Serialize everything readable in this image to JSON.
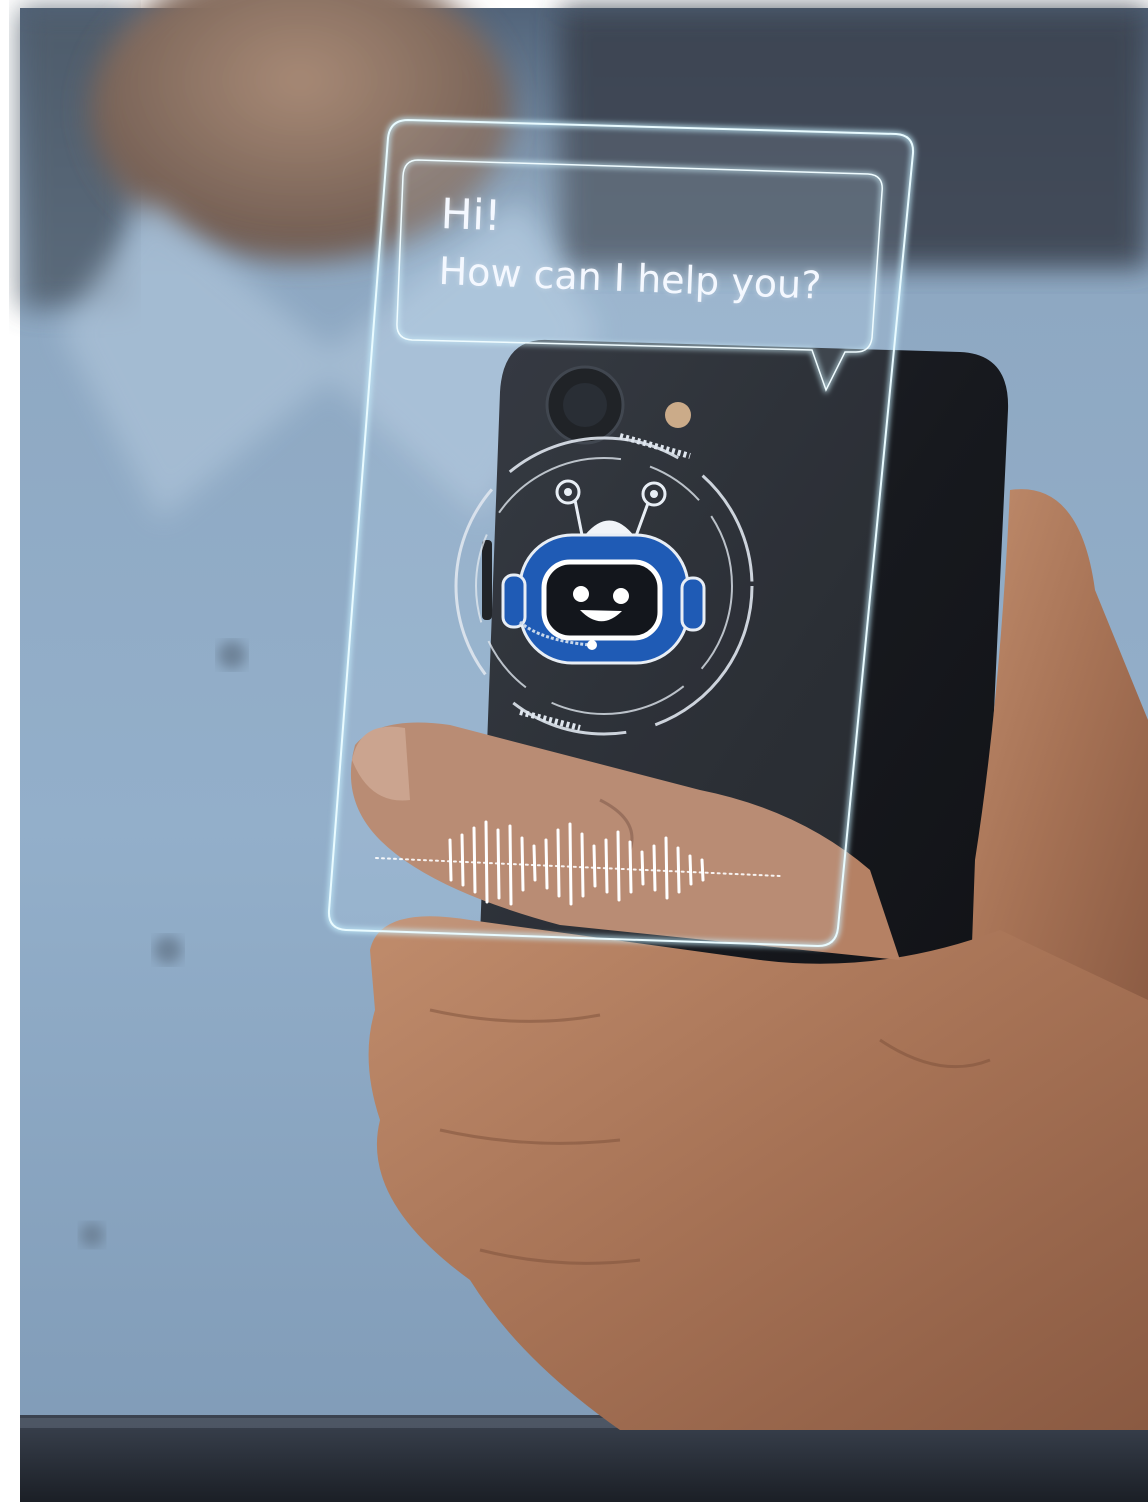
{
  "chat_bubble": {
    "greeting": "Hi!",
    "question": "How can I help you?"
  },
  "icons": {
    "robot": "robot-assistant-icon",
    "waveform": "voice-waveform-icon"
  },
  "colors": {
    "shirt_blue": "#8fa9c4",
    "phone_black": "#15171c",
    "hologram_cyan": "#b9ecff",
    "robot_blue": "#1f5bb5",
    "skin": "#b07a5a"
  }
}
